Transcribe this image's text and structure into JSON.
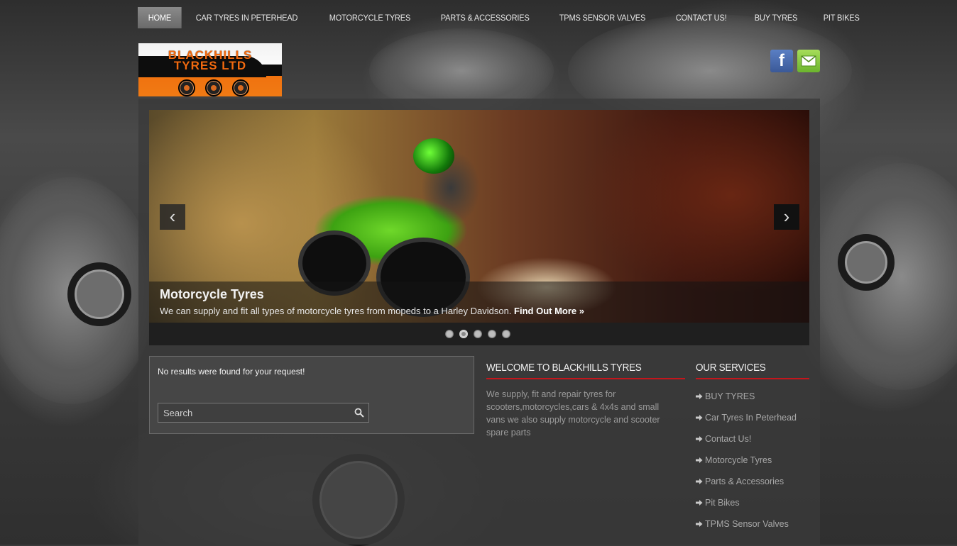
{
  "nav": [
    {
      "label": "HOME",
      "active": true
    },
    {
      "label": "CAR TYRES IN PETERHEAD"
    },
    {
      "label": "MOTORCYCLE TYRES"
    },
    {
      "label": "PARTS & ACCESSORIES"
    },
    {
      "label": "TPMS SENSOR VALVES"
    },
    {
      "label": "CONTACT US!"
    },
    {
      "label": "BUY TYRES"
    },
    {
      "label": "PIT BIKES"
    }
  ],
  "logo": {
    "line1": "BLACKHILLS",
    "line2": "TYRES LTD"
  },
  "social": {
    "facebook_glyph": "f",
    "mail_icon": "mail-icon"
  },
  "slider": {
    "title": "Motorcycle Tyres",
    "text": "We can supply and fit all types of motorcycle tyres from mopeds to a Harley Davidson.",
    "link": "Find Out More »",
    "prev_glyph": "‹",
    "next_glyph": "›",
    "dots": 5,
    "active_dot": 2
  },
  "results": {
    "message": "No results were found for your request!",
    "search_placeholder": "Search"
  },
  "welcome": {
    "title": "WELCOME TO BLACKHILLS TYRES",
    "text": "We supply, fit and repair tyres for scooters,motorcycles,cars & 4x4s and small vans we also supply motorcycle and scooter spare parts"
  },
  "services": {
    "title": "OUR SERVICES",
    "items": [
      "BUY TYRES",
      "Car Tyres In Peterhead",
      "Contact Us!",
      "Motorcycle Tyres",
      "Parts & Accessories",
      "Pit Bikes",
      "TPMS Sensor Valves"
    ]
  },
  "colors": {
    "accent_red": "#c4161c",
    "logo_orange": "#f26a10",
    "facebook_blue": "#3b5998",
    "mail_green": "#6cb52e"
  }
}
